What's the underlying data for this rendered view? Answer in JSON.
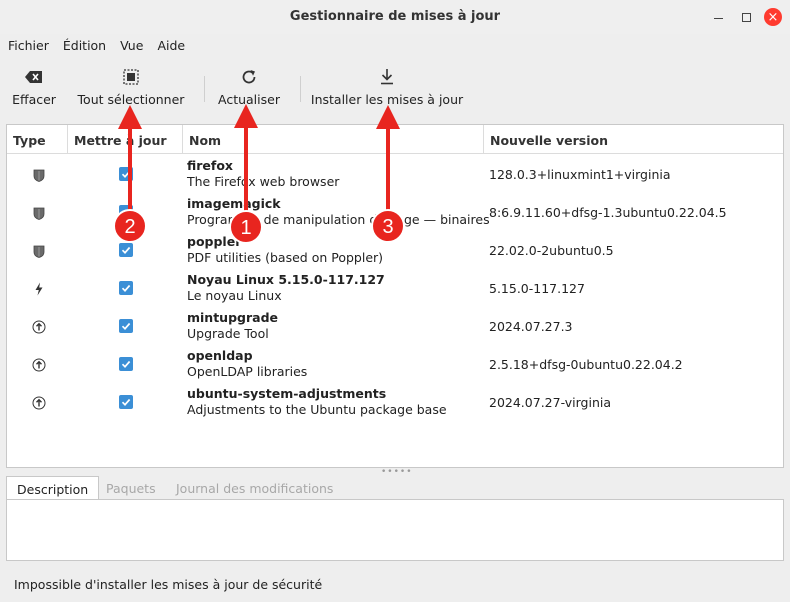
{
  "window": {
    "title": "Gestionnaire de mises à jour",
    "close_glyph": "×"
  },
  "menu": [
    "Fichier",
    "Édition",
    "Vue",
    "Aide"
  ],
  "toolbar": {
    "clear_label": "Effacer",
    "select_all_label": "Tout sélectionner",
    "refresh_label": "Actualiser",
    "install_label": "Installer les mises à jour"
  },
  "columns": {
    "type": "Type",
    "update": "Mettre à jour",
    "name": "Nom",
    "version": "Nouvelle version"
  },
  "updates": [
    {
      "type_icon": "shield-icon",
      "checked": true,
      "name": "firefox",
      "description": "The Firefox web browser",
      "version": "128.0.3+linuxmint1+virginia"
    },
    {
      "type_icon": "shield-icon",
      "checked": true,
      "name": "imagemagick",
      "description": "Programme de manipulation d'image — binaires",
      "version": "8:6.9.11.60+dfsg-1.3ubuntu0.22.04.5"
    },
    {
      "type_icon": "shield-icon",
      "checked": true,
      "name": "poppler",
      "description": "PDF utilities (based on Poppler)",
      "version": "22.02.0-2ubuntu0.5"
    },
    {
      "type_icon": "lightning-icon",
      "checked": true,
      "name": "Noyau Linux 5.15.0-117.127",
      "description": "Le noyau Linux",
      "version": "5.15.0-117.127"
    },
    {
      "type_icon": "upgrade-arrow-icon",
      "checked": true,
      "name": "mintupgrade",
      "description": "Upgrade Tool",
      "version": "2024.07.27.3"
    },
    {
      "type_icon": "upgrade-arrow-icon",
      "checked": true,
      "name": "openldap",
      "description": "OpenLDAP libraries",
      "version": "2.5.18+dfsg-0ubuntu0.22.04.2"
    },
    {
      "type_icon": "upgrade-arrow-icon",
      "checked": true,
      "name": "ubuntu-system-adjustments",
      "description": "Adjustments to the Ubuntu package base",
      "version": "2024.07.27-virginia"
    }
  ],
  "tabs": [
    "Description",
    "Paquets",
    "Journal des modifications"
  ],
  "status": "Impossible d'installer les mises à jour de sécurité",
  "annotations": [
    "1",
    "2",
    "3"
  ],
  "colors": {
    "annotation_red": "#e8251f",
    "checkbox_blue": "#3b8fd6",
    "close_red": "#ff3b2f"
  }
}
